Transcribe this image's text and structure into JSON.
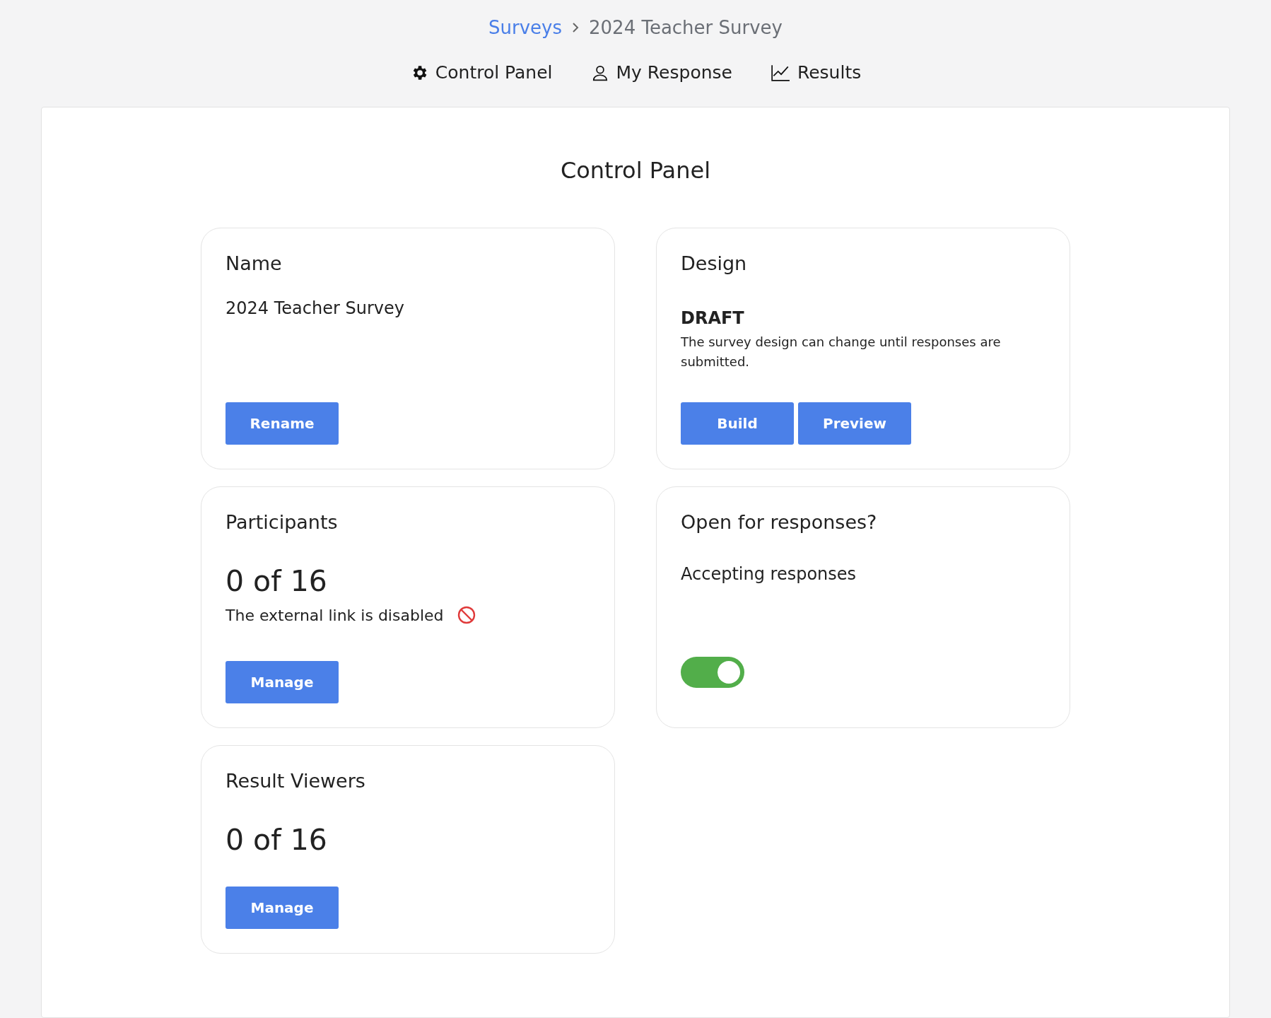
{
  "breadcrumb": {
    "link": "Surveys",
    "current": "2024 Teacher Survey"
  },
  "nav": [
    {
      "label": "Control Panel"
    },
    {
      "label": "My Response"
    },
    {
      "label": "Results"
    }
  ],
  "panel": {
    "title": "Control Panel",
    "cards": [
      {
        "kind": "text",
        "title": "Name",
        "value": "2024 Teacher Survey",
        "buttons": [
          "Rename"
        ]
      },
      {
        "kind": "status",
        "title": "Design",
        "status": "DRAFT",
        "note": "The survey design can change until responses are submitted.",
        "buttons": [
          "Build",
          "Preview"
        ]
      },
      {
        "kind": "count",
        "title": "Participants",
        "count": "0 of 16",
        "note": "The external link is disabled",
        "buttons": [
          "Manage"
        ]
      },
      {
        "kind": "toggle",
        "title": "Open for responses?",
        "value": "Accepting responses",
        "on": true
      },
      {
        "kind": "count",
        "title": "Result Viewers",
        "count": "0 of 16",
        "buttons": [
          "Manage"
        ]
      }
    ]
  }
}
